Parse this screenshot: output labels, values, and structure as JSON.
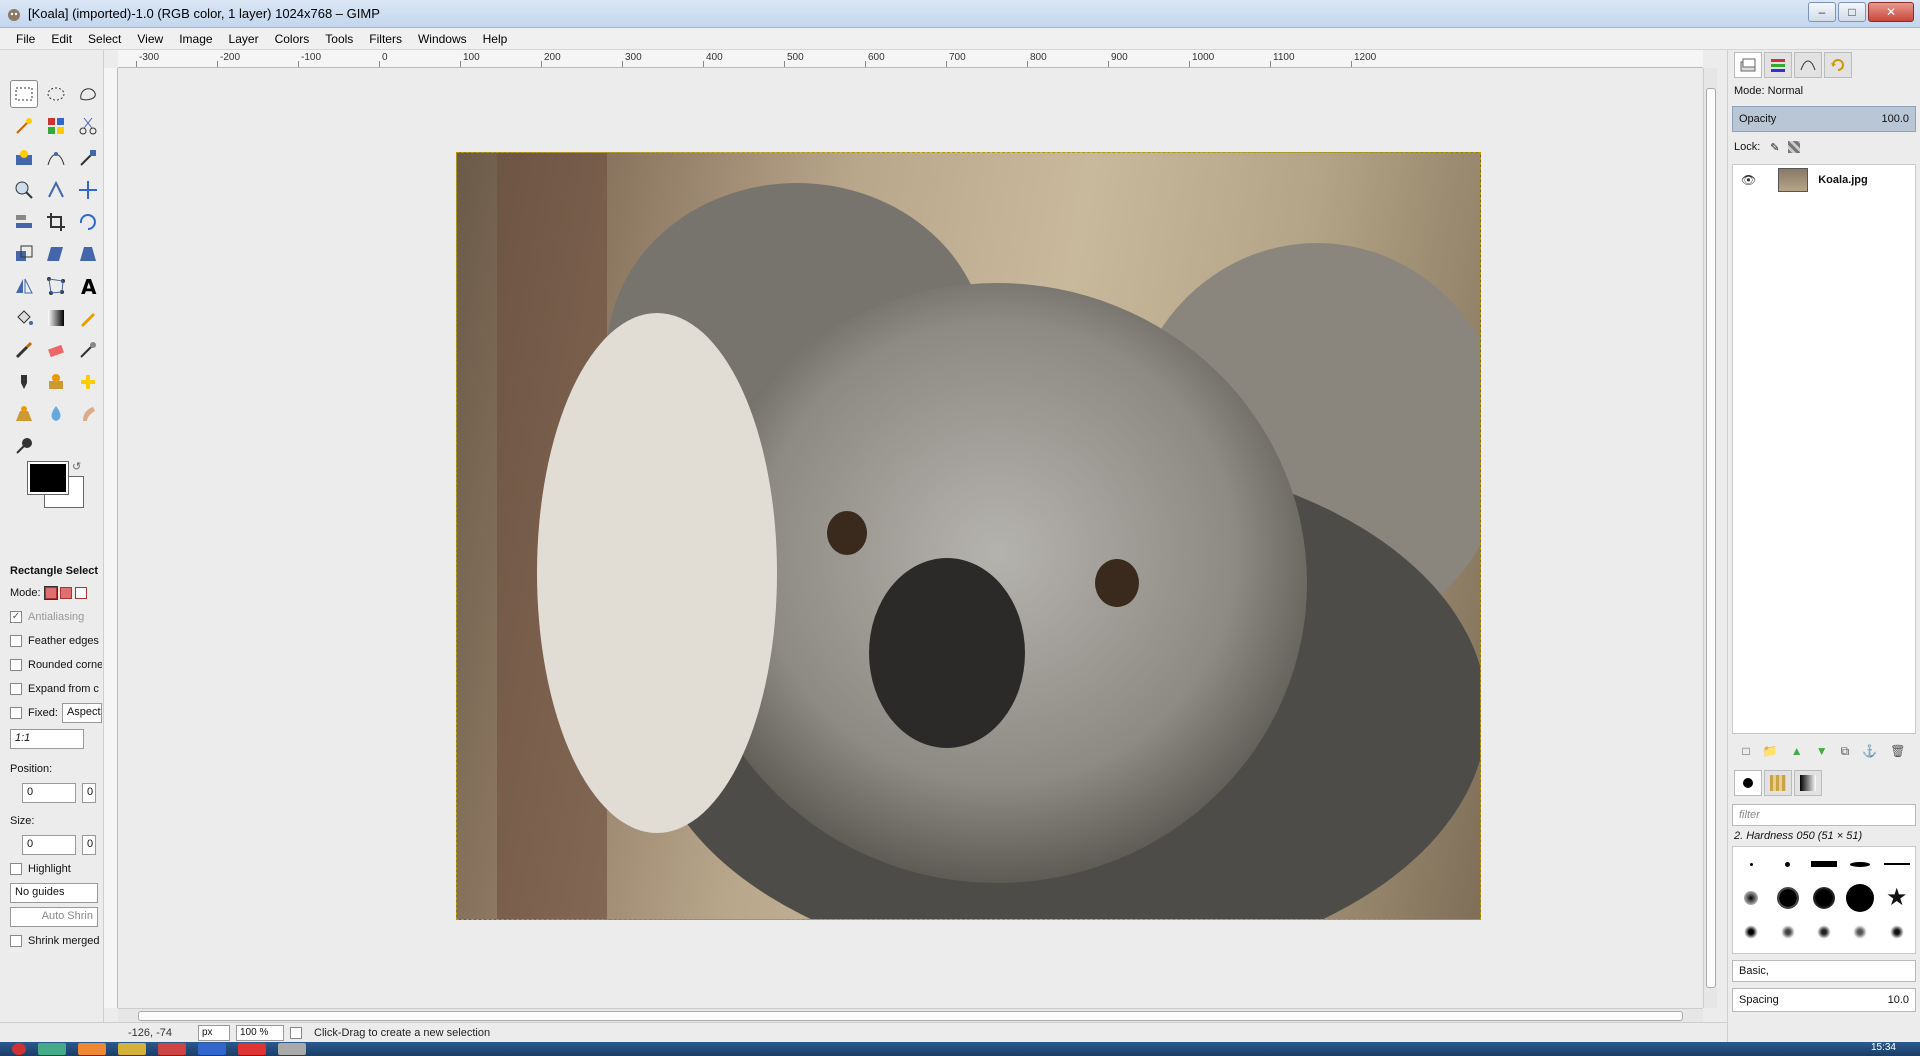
{
  "window": {
    "title": "[Koala] (imported)-1.0 (RGB color, 1 layer) 1024x768 – GIMP"
  },
  "menubar": [
    "File",
    "Edit",
    "Select",
    "View",
    "Image",
    "Layer",
    "Colors",
    "Tools",
    "Filters",
    "Windows",
    "Help"
  ],
  "ruler": {
    "labels": [
      "-300",
      "-200",
      "-100",
      "0",
      "100",
      "200",
      "300",
      "400",
      "500",
      "600",
      "700",
      "800",
      "900",
      "1000",
      "1100",
      "1200"
    ]
  },
  "tools": [
    "rect-select",
    "ellipse-select",
    "free-select",
    "fuzzy-select",
    "select-by-color",
    "scissors",
    "foreground-select",
    "paths",
    "color-picker",
    "zoom",
    "measure",
    "move",
    "align",
    "crop",
    "rotate",
    "scale",
    "shear",
    "perspective",
    "flip",
    "cage-transform",
    "text",
    "bucket-fill",
    "blend",
    "pencil",
    "paintbrush",
    "eraser",
    "airbrush",
    "ink",
    "clone",
    "heal",
    "perspective-clone",
    "blur",
    "smudge",
    "dodge-burn"
  ],
  "tool_options": {
    "title": "Rectangle Select",
    "mode_label": "Mode:",
    "antialiasing": "Antialiasing",
    "feather": "Feather edges",
    "rounded": "Rounded corne",
    "expand": "Expand from c",
    "fixed_label": "Fixed:",
    "fixed_value": "Aspect",
    "ratio": "1:1",
    "position_label": "Position:",
    "position_x": "0",
    "position_y": "0",
    "size_label": "Size:",
    "size_w": "0",
    "size_h": "0",
    "highlight": "Highlight",
    "guides": "No guides",
    "auto_shrink": "Auto Shrin",
    "shrink_merged": "Shrink merged"
  },
  "statusbar": {
    "coords": "-126, -74",
    "unit": "px",
    "zoom": "100 %",
    "message": "Click-Drag to create a new selection"
  },
  "layers": {
    "mode": "Mode: Normal",
    "opacity_label": "Opacity",
    "opacity_value": "100.0",
    "lock_label": "Lock:",
    "items": [
      {
        "name": "Koala.jpg",
        "visible": true
      }
    ]
  },
  "brushes": {
    "filter_placeholder": "filter",
    "selected": "2. Hardness 050 (51 × 51)",
    "preset": "Basic,",
    "spacing_label": "Spacing",
    "spacing_value": "10.0"
  },
  "taskbar": {
    "time": "15:34"
  },
  "colors": {
    "foreground": "#000000",
    "background": "#ffffff",
    "selection": "#b39a00"
  }
}
